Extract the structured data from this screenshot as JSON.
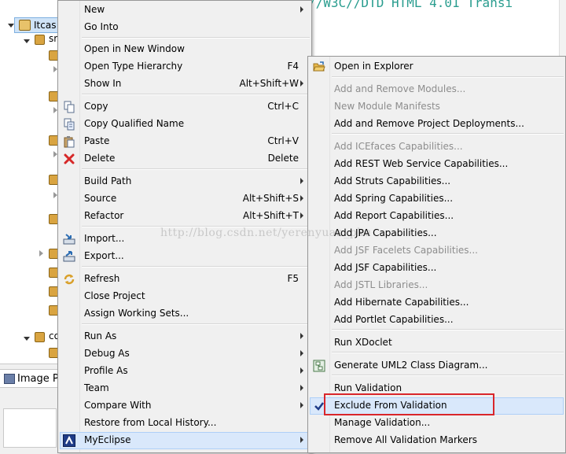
{
  "colors": {
    "accent_highlight": "#d9e8fb",
    "callout": "#d9262b",
    "disabled_text": "#8d8d8d",
    "code": "#2a9d8f"
  },
  "background": {
    "editor_code": "//W3C//DTD HTML 4.01 Transi",
    "tree_root_label": "Itcas",
    "tree_child_label_1": "sr",
    "tree_child_label_2": "co",
    "bottom_view_tab": "Image P"
  },
  "context_menu": {
    "items": [
      {
        "label": "New",
        "shortcut": "",
        "submenu": true
      },
      {
        "label": "Go Into",
        "shortcut": "",
        "submenu": false
      },
      {
        "label": "Open in New Window",
        "shortcut": "",
        "submenu": false
      },
      {
        "label": "Open Type Hierarchy",
        "shortcut": "F4",
        "submenu": false
      },
      {
        "label": "Show In",
        "shortcut": "Alt+Shift+W",
        "submenu": true
      },
      {
        "label": "Copy",
        "shortcut": "Ctrl+C",
        "submenu": false,
        "icon": "copy-icon"
      },
      {
        "label": "Copy Qualified Name",
        "shortcut": "",
        "submenu": false,
        "icon": "copy-qualified-icon"
      },
      {
        "label": "Paste",
        "shortcut": "Ctrl+V",
        "submenu": false,
        "icon": "paste-icon"
      },
      {
        "label": "Delete",
        "shortcut": "Delete",
        "submenu": false,
        "icon": "delete-icon"
      },
      {
        "label": "Build Path",
        "shortcut": "",
        "submenu": true
      },
      {
        "label": "Source",
        "shortcut": "Alt+Shift+S",
        "submenu": true
      },
      {
        "label": "Refactor",
        "shortcut": "Alt+Shift+T",
        "submenu": true
      },
      {
        "label": "Import...",
        "shortcut": "",
        "submenu": false,
        "icon": "import-icon"
      },
      {
        "label": "Export...",
        "shortcut": "",
        "submenu": false,
        "icon": "export-icon"
      },
      {
        "label": "Refresh",
        "shortcut": "F5",
        "submenu": false,
        "icon": "refresh-icon"
      },
      {
        "label": "Close Project",
        "shortcut": "",
        "submenu": false
      },
      {
        "label": "Assign Working Sets...",
        "shortcut": "",
        "submenu": false
      },
      {
        "label": "Run As",
        "shortcut": "",
        "submenu": true
      },
      {
        "label": "Debug As",
        "shortcut": "",
        "submenu": true
      },
      {
        "label": "Profile As",
        "shortcut": "",
        "submenu": true
      },
      {
        "label": "Team",
        "shortcut": "",
        "submenu": true
      },
      {
        "label": "Compare With",
        "shortcut": "",
        "submenu": true
      },
      {
        "label": "Restore from Local History...",
        "shortcut": "",
        "submenu": false
      },
      {
        "label": "MyEclipse",
        "shortcut": "",
        "submenu": true,
        "icon": "myeclipse-icon",
        "highlighted": true
      }
    ]
  },
  "submenu": {
    "items": [
      {
        "label": "Open in Explorer",
        "enabled": true,
        "icon": "folder-open-icon"
      },
      {
        "label": "Add and Remove Modules...",
        "enabled": false
      },
      {
        "label": "New Module Manifests",
        "enabled": false
      },
      {
        "label": "Add and Remove Project Deployments...",
        "enabled": true
      },
      {
        "label": "Add ICEfaces Capabilities...",
        "enabled": false
      },
      {
        "label": "Add REST Web Service Capabilities...",
        "enabled": true
      },
      {
        "label": "Add Struts Capabilities...",
        "enabled": true
      },
      {
        "label": "Add Spring Capabilities...",
        "enabled": true
      },
      {
        "label": "Add Report Capabilities...",
        "enabled": true
      },
      {
        "label": "Add JPA Capabilities...",
        "enabled": true
      },
      {
        "label": "Add JSF Facelets Capabilities...",
        "enabled": false
      },
      {
        "label": "Add JSF Capabilities...",
        "enabled": true
      },
      {
        "label": "Add JSTL Libraries...",
        "enabled": false
      },
      {
        "label": "Add Hibernate Capabilities...",
        "enabled": true
      },
      {
        "label": "Add Portlet Capabilities...",
        "enabled": true
      },
      {
        "label": "Run XDoclet",
        "enabled": true
      },
      {
        "label": "Generate UML2 Class Diagram...",
        "enabled": true,
        "icon": "uml-icon"
      },
      {
        "label": "Run Validation",
        "enabled": true
      },
      {
        "label": "Exclude From Validation",
        "enabled": true,
        "checked": true,
        "icon": "checkmark-icon"
      },
      {
        "label": "Manage Validation...",
        "enabled": true
      },
      {
        "label": "Remove All Validation Markers",
        "enabled": true
      }
    ]
  },
  "watermark": "http://blog.csdn.net/yerenyuan_pku"
}
